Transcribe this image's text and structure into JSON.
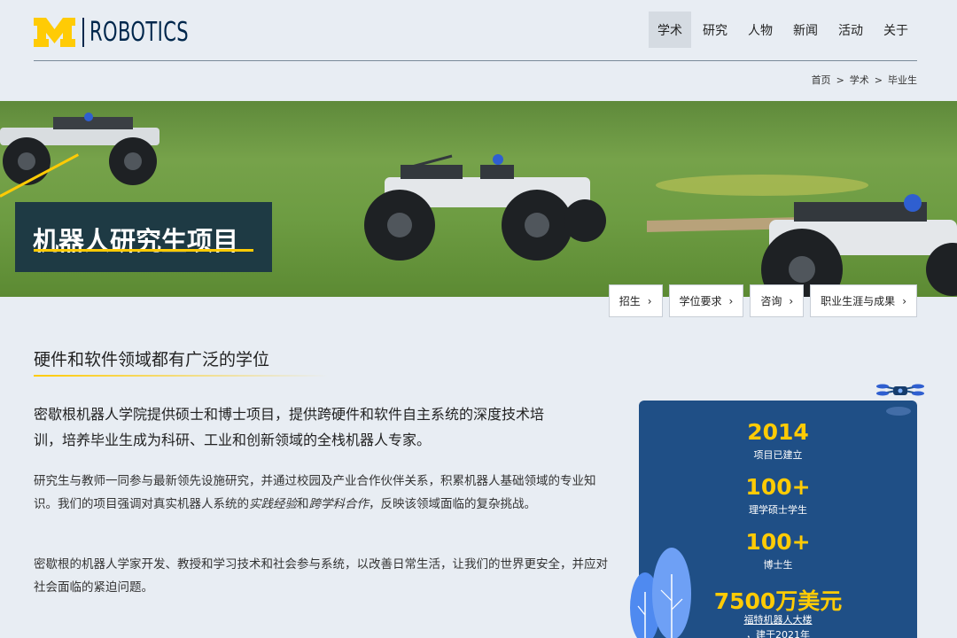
{
  "header": {
    "logo_text": "ROBOTICS",
    "nav": [
      "学术",
      "研究",
      "人物",
      "新闻",
      "活动",
      "关于"
    ]
  },
  "breadcrumb": [
    "首页",
    "学术",
    "毕业生"
  ],
  "hero": {
    "title": "机器人研究生项目"
  },
  "pills": [
    "招生",
    "学位要求",
    "咨询",
    "职业生涯与成果"
  ],
  "content": {
    "section_title": "硬件和软件领域都有广泛的学位",
    "lead": "密歇根机器人学院提供硕士和博士项目，提供跨硬件和软件自主系统的深度技术培训，培养毕业生成为科研、工业和创新领域的全栈机器人专家。",
    "p1_a": "研究生与教师一同参与最新领先设施研究，并通过校园及产业合作伙伴关系，积累机器人基础领域的专业知识。我们的项目强调对真实机器人系统的",
    "p1_em1": "实践经验",
    "p1_b": "和",
    "p1_em2": "跨学科合作",
    "p1_c": "，反映该领域面临的复杂挑战。",
    "p2": "密歇根的机器人学家开发、教授和学习技术和社会参与系统，以改善日常生活，让我们的世界更安全，并应对社会面临的紧迫问题。"
  },
  "stats": [
    {
      "value": "2014",
      "label": "项目已建立"
    },
    {
      "value": "100+",
      "label": "理学硕士学生"
    },
    {
      "value": "100+",
      "label": "博士生"
    },
    {
      "value": "7500万美元",
      "label": "福特机器人大楼",
      "sub": "，建于2021年"
    }
  ],
  "colors": {
    "maize": "#ffcb05",
    "blue": "#00274c",
    "panel": "#1f4f86"
  }
}
